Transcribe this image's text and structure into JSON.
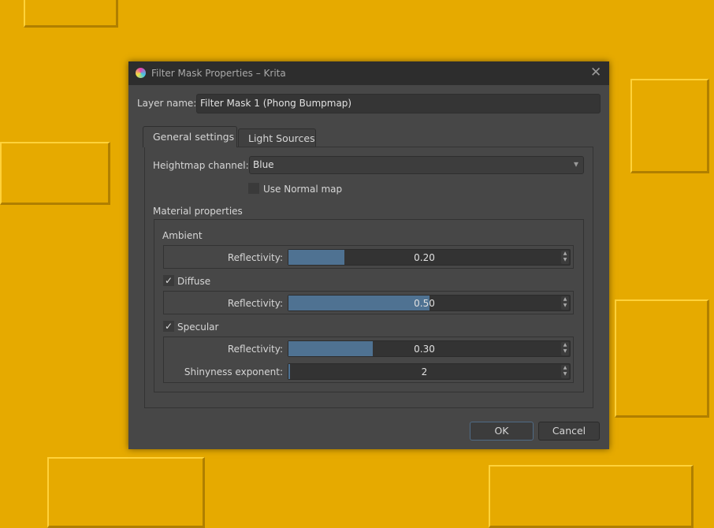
{
  "window": {
    "title": "Filter Mask Properties – Krita"
  },
  "layer_name": {
    "label": "Layer name:",
    "value": "Filter Mask 1 (Phong Bumpmap)"
  },
  "tabs": [
    {
      "label": "General settings",
      "active": true
    },
    {
      "label": "Light Sources",
      "active": false
    }
  ],
  "heightmap": {
    "label": "Heightmap channel:",
    "value": "Blue"
  },
  "use_normal_map": {
    "label": "Use Normal map",
    "checked": false
  },
  "material": {
    "title": "Material properties",
    "ambient": {
      "title": "Ambient",
      "reflectivity_label": "Reflectivity:",
      "reflectivity": "0.20",
      "fraction": 0.2
    },
    "diffuse": {
      "title": "Diffuse",
      "checked": true,
      "reflectivity_label": "Reflectivity:",
      "reflectivity": "0.50",
      "fraction": 0.5
    },
    "specular": {
      "title": "Specular",
      "checked": true,
      "reflectivity_label": "Reflectivity:",
      "reflectivity": "0.30",
      "fraction": 0.3,
      "shininess_label": "Shinyness exponent:",
      "shininess": "2",
      "shininess_fraction": 0.005
    }
  },
  "buttons": {
    "ok": "OK",
    "cancel": "Cancel"
  },
  "icons": {
    "check": "✓",
    "close": "✕",
    "dropdown": "▾"
  }
}
